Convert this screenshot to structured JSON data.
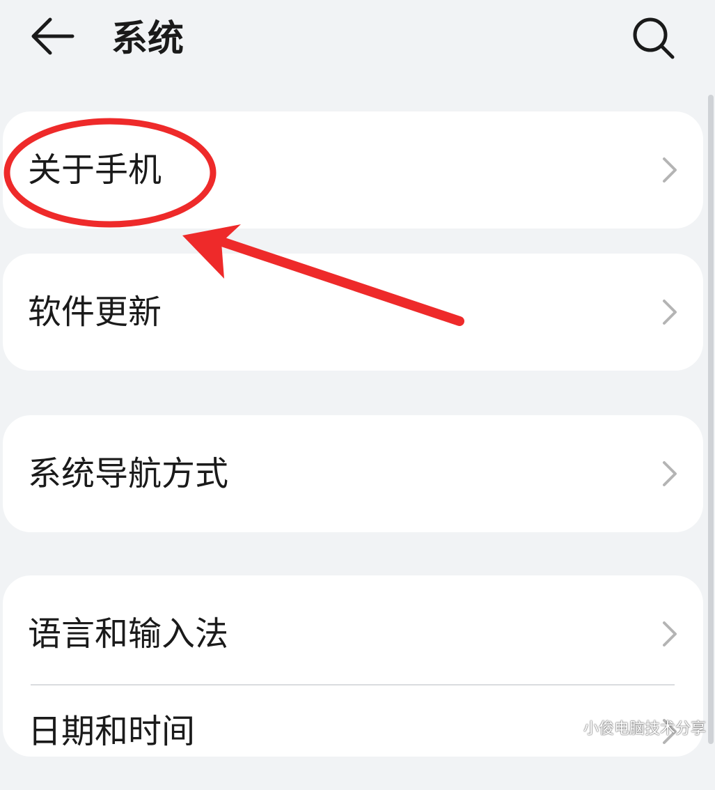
{
  "header": {
    "title": "系统",
    "back_icon": "arrow-left-icon",
    "search_icon": "search-icon"
  },
  "groups": [
    {
      "items": [
        {
          "label": "关于手机",
          "icon": "chevron-right-icon"
        }
      ]
    },
    {
      "items": [
        {
          "label": "软件更新",
          "icon": "chevron-right-icon"
        }
      ]
    },
    {
      "items": [
        {
          "label": "系统导航方式",
          "icon": "chevron-right-icon"
        }
      ]
    },
    {
      "items": [
        {
          "label": "语言和输入法",
          "icon": "chevron-right-icon"
        },
        {
          "label": "日期和时间",
          "icon": "chevron-right-icon"
        }
      ]
    }
  ],
  "annotation": {
    "color": "#ee2a2a",
    "highlighted_item": "关于手机"
  },
  "watermark": "小俊电脑技术分享",
  "colors": {
    "background": "#f1f3f5",
    "card": "#ffffff",
    "text": "#1a1a1a",
    "chevron": "#b4b4b4"
  }
}
